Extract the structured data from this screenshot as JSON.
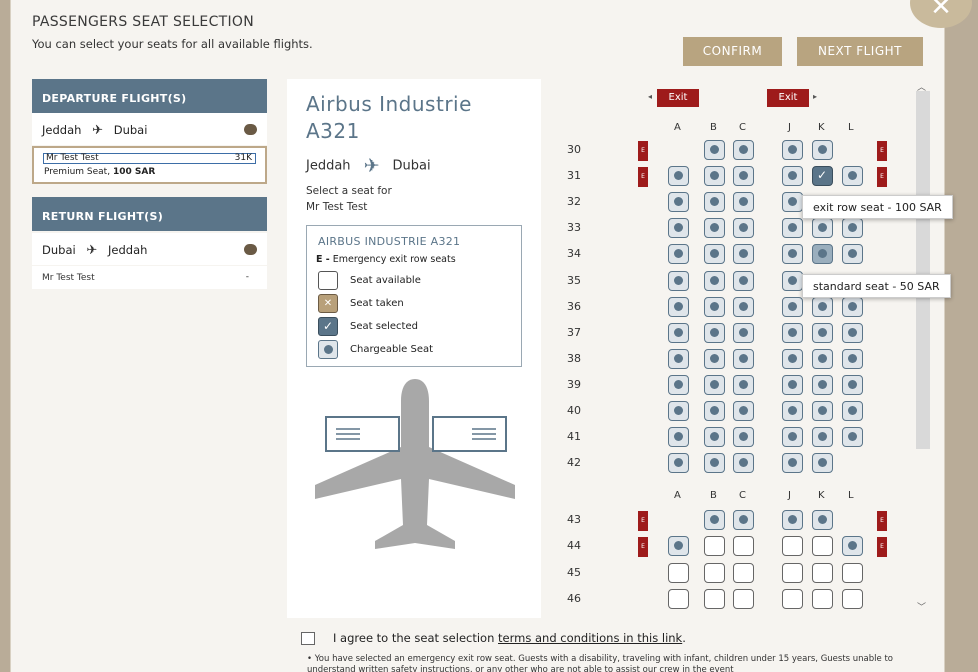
{
  "header": {
    "title": "PASSENGERS SEAT SELECTION",
    "subtitle": "You can select your seats for all available flights.",
    "confirm_label": "CONFIRM",
    "next_label": "NEXT FLIGHT",
    "close_icon": "✕"
  },
  "departure": {
    "heading": "DEPARTURE FLIGHT(S)",
    "from": "Jeddah",
    "to": "Dubai",
    "passenger": "Mr Test Test",
    "seat_number": "31K",
    "seat_desc": "Premium Seat,",
    "seat_price": "100 SAR"
  },
  "return": {
    "heading": "RETURN FLIGHT(S)",
    "from": "Dubai",
    "to": "Jeddah",
    "passenger": "Mr Test Test",
    "seat_number": "-"
  },
  "aircraft": {
    "name_line1": "Airbus Industrie",
    "name_line2": "A321",
    "from": "Jeddah",
    "to": "Dubai",
    "select_prompt": "Select a seat for",
    "passenger": "Mr Test Test"
  },
  "legend": {
    "title": "AIRBUS INDUSTRIE A321",
    "exit_code": "E -",
    "exit_desc": "Emergency exit row seats",
    "items": [
      {
        "label": "Seat available",
        "icon": "seat-available-icon"
      },
      {
        "label": "Seat taken",
        "icon": "seat-taken-icon"
      },
      {
        "label": "Seat selected",
        "icon": "seat-selected-icon"
      },
      {
        "label": "Chargeable Seat",
        "icon": "seat-chargeable-icon"
      }
    ]
  },
  "seatmap": {
    "exit_label": "Exit",
    "exit_mark": "E",
    "columns": [
      "A",
      "B",
      "C",
      "J",
      "K",
      "L"
    ],
    "rows_top": [
      "30",
      "31",
      "32",
      "33",
      "34",
      "35",
      "36",
      "37",
      "38",
      "39",
      "40",
      "41",
      "42"
    ],
    "rows_bottom": [
      "43",
      "44",
      "45",
      "46"
    ],
    "tooltip_exit": "exit row seat - 100 SAR",
    "tooltip_standard": "standard seat - 50 SAR"
  },
  "footer": {
    "agree_prefix": "I agree to the seat selection",
    "agree_link": "terms and conditions in this link",
    "agree_suffix": ".",
    "notice": "• You have selected an emergency exit row seat. Guests with a disability, traveling with infant, children under 15 years, Guests unable to understand written safety instructions, or any other who are not able to assist our crew in the event"
  },
  "colors": {
    "accent": "#5b7589",
    "button": "#b8a480",
    "exit": "#9e1b1b"
  }
}
